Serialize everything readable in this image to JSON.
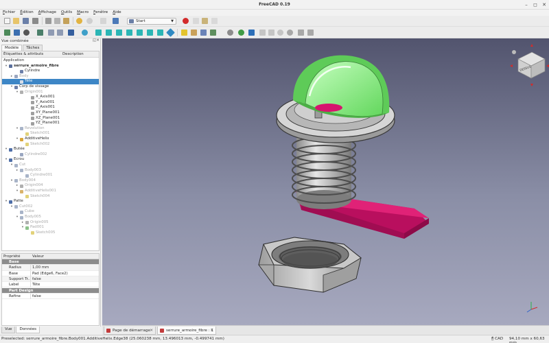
{
  "window": {
    "title": "FreeCAD 0.19"
  },
  "menu": [
    "Fichier",
    "Édition",
    "Affichage",
    "Outils",
    "Macro",
    "Fenêtre",
    "Aide"
  ],
  "toolbar": {
    "workbench": "Start"
  },
  "combo": {
    "title": "Vue combinée",
    "tabs": [
      "Modèle",
      "Tâches"
    ],
    "tree_headers": [
      "Étiquettes & attributs",
      "Description"
    ],
    "tree": [
      {
        "label": "Application",
        "indent": 0,
        "state": "normal"
      },
      {
        "label": "serrure_armoire_fibre",
        "indent": 1,
        "state": "bold",
        "expander": "▾",
        "icon": "document-icon",
        "color": "#5a6f9c"
      },
      {
        "label": "Cylindre",
        "indent": 3,
        "state": "normal",
        "icon": "part-icon",
        "color": "#6c7fa8"
      },
      {
        "label": "Body",
        "indent": 2,
        "state": "dim",
        "expander": "▸",
        "icon": "body-icon",
        "color": "#9aa6c0"
      },
      {
        "label": "Tête",
        "indent": 3,
        "state": "selected",
        "icon": "part-icon",
        "color": "#d7dde8"
      },
      {
        "label": "Corp de vissage",
        "indent": 2,
        "state": "normal",
        "expander": "▾",
        "icon": "body-icon",
        "color": "#6c7fa8"
      },
      {
        "label": "Origin001",
        "indent": 3,
        "state": "dim",
        "expander": "▾",
        "icon": "origin-icon",
        "color": "#b0b0b0"
      },
      {
        "label": "X_Axis001",
        "indent": 5,
        "state": "normal",
        "icon": "axis-icon",
        "color": "#9f9f9f"
      },
      {
        "label": "Y_Axis001",
        "indent": 5,
        "state": "normal",
        "icon": "axis-icon",
        "color": "#9f9f9f"
      },
      {
        "label": "Z_Axis001",
        "indent": 5,
        "state": "normal",
        "icon": "axis-icon",
        "color": "#9f9f9f"
      },
      {
        "label": "XY_Plane001",
        "indent": 5,
        "state": "normal",
        "icon": "plane-icon",
        "color": "#9f9f9f"
      },
      {
        "label": "XZ_Plane001",
        "indent": 5,
        "state": "normal",
        "icon": "plane-icon",
        "color": "#9f9f9f"
      },
      {
        "label": "YZ_Plane001",
        "indent": 5,
        "state": "normal",
        "icon": "plane-icon",
        "color": "#9f9f9f"
      },
      {
        "label": "Revolution",
        "indent": 3,
        "state": "dim",
        "expander": "▾",
        "icon": "revolution-icon",
        "color": "#a8b4c8"
      },
      {
        "label": "Sketch001",
        "indent": 4,
        "state": "dim",
        "icon": "sketch-icon",
        "color": "#e2d27a"
      },
      {
        "label": "AdditiveHelix",
        "indent": 3,
        "state": "normal",
        "expander": "▾",
        "icon": "helix-icon",
        "color": "#d9a63a"
      },
      {
        "label": "Sketch002",
        "indent": 4,
        "state": "dim",
        "icon": "sketch-icon",
        "color": "#e2d27a"
      },
      {
        "label": "Butée",
        "indent": 1,
        "state": "normal",
        "expander": "▾",
        "icon": "body-icon",
        "color": "#4f6fa8"
      },
      {
        "label": "Cylindre002",
        "indent": 3,
        "state": "dim",
        "icon": "part-icon",
        "color": "#9aa6c0"
      },
      {
        "label": "Ecrou",
        "indent": 1,
        "state": "normal",
        "expander": "▾",
        "icon": "body-icon",
        "color": "#4f6fa8"
      },
      {
        "label": "Cut",
        "indent": 2,
        "state": "dim",
        "expander": "▾",
        "icon": "cut-icon",
        "color": "#a8b4c8"
      },
      {
        "label": "Body003",
        "indent": 3,
        "state": "dim",
        "expander": "▸",
        "icon": "body-icon",
        "color": "#a8b4c8"
      },
      {
        "label": "Cylindre001",
        "indent": 4,
        "state": "dim",
        "icon": "part-icon",
        "color": "#a8b4c8"
      },
      {
        "label": "Body004",
        "indent": 2,
        "state": "dim",
        "expander": "▾",
        "icon": "body-icon",
        "color": "#a8b4c8"
      },
      {
        "label": "Origin004",
        "indent": 3,
        "state": "dim",
        "expander": "▸",
        "icon": "origin-icon",
        "color": "#b0b0b0"
      },
      {
        "label": "AdditiveHelix001",
        "indent": 3,
        "state": "dim",
        "expander": "▾",
        "icon": "helix-icon",
        "color": "#d9b36a"
      },
      {
        "label": "Sketch004",
        "indent": 4,
        "state": "dim",
        "icon": "sketch-icon",
        "color": "#e2d27a"
      },
      {
        "label": "Patte",
        "indent": 1,
        "state": "normal",
        "expander": "▾",
        "icon": "body-icon",
        "color": "#4f6fa8"
      },
      {
        "label": "Cut002",
        "indent": 2,
        "state": "dim",
        "expander": "▾",
        "icon": "cut-icon",
        "color": "#a8b4c8"
      },
      {
        "label": "Cube",
        "indent": 3,
        "state": "dim",
        "icon": "part-icon",
        "color": "#a8b4c8"
      },
      {
        "label": "Body005",
        "indent": 3,
        "state": "dim",
        "expander": "▾",
        "icon": "body-icon",
        "color": "#a8b4c8"
      },
      {
        "label": "Origin005",
        "indent": 4,
        "state": "dim",
        "expander": "▸",
        "icon": "origin-icon",
        "color": "#b0b0b0"
      },
      {
        "label": "Pad001",
        "indent": 4,
        "state": "dim",
        "expander": "▾",
        "icon": "pad-icon",
        "color": "#8cc28a"
      },
      {
        "label": "Sketch005",
        "indent": 5,
        "state": "dim",
        "icon": "sketch-icon",
        "color": "#e2d27a"
      }
    ]
  },
  "properties": {
    "headers": [
      "Propriété",
      "Valeur"
    ],
    "rows": [
      {
        "group": "Base"
      },
      {
        "key": "Radius",
        "value": "1,00 mm"
      },
      {
        "key": "Base",
        "value": "Pad (Edge6, Face2)"
      },
      {
        "key": "Support Tr...",
        "value": "false"
      },
      {
        "key": "Label",
        "value": "Tête"
      },
      {
        "group": "Part Design"
      },
      {
        "key": "Refine",
        "value": "false"
      }
    ]
  },
  "bottom_tabs": [
    "Vue",
    "Données"
  ],
  "doc_tabs": [
    {
      "label": "Page de démarrage",
      "active": false
    },
    {
      "label": "serrure_armoire_fibre : 1",
      "active": true
    }
  ],
  "navcube": {
    "face_label": "DESSUS"
  },
  "status": {
    "message": "Preselected: serrure_armoire_fibre.Body001.AdditiveHelix.Edge38 (25.060238 mm, 13.496013 mm, -0.499741 mm)",
    "nav_style": "CAD",
    "dimensions": "94,10 mm x 60,63 mm"
  },
  "colors": {
    "selection": "#3d86c6",
    "dome_green": "#8cf58a",
    "lever_magenta": "#d6156e",
    "metal_grey": "#c8c8c8"
  }
}
